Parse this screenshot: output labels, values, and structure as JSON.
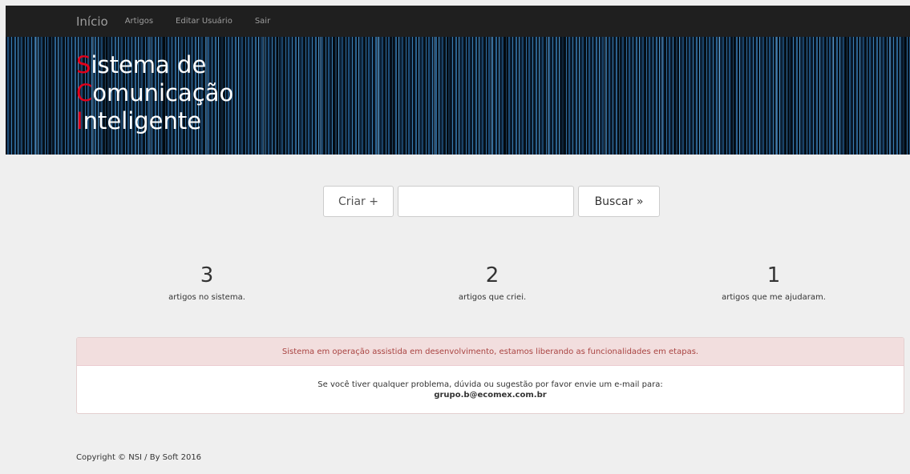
{
  "navbar": {
    "brand": "Início",
    "links": [
      "Artigos",
      "Editar Usuário",
      "Sair"
    ]
  },
  "banner": {
    "lines": [
      {
        "cap": "S",
        "rest": "istema de"
      },
      {
        "cap": "C",
        "rest": "omunicação"
      },
      {
        "cap": "I",
        "rest": "nteligente"
      }
    ]
  },
  "search": {
    "create_label": "Criar +",
    "input_value": "",
    "search_label": "Buscar »"
  },
  "stats": [
    {
      "value": "3",
      "label": "artigos no sistema."
    },
    {
      "value": "2",
      "label": "artigos que criei."
    },
    {
      "value": "1",
      "label": "artigos que me ajudaram."
    }
  ],
  "notice": {
    "heading": "Sistema em operação assistida em desenvolvimento, estamos liberando as funcionalidades em etapas.",
    "body": "Se você tiver qualquer problema, dúvida ou sugestão por favor envie um e-mail para:",
    "email": "grupo.b@ecomex.com.br"
  },
  "footer": {
    "copyright": "Copyright © NSI / By Soft 2016"
  },
  "colors": {
    "navbar_bg": "#1f1f1f",
    "accent_red": "#e3001b",
    "alert_bg": "#f2dede",
    "alert_text": "#a94442"
  }
}
